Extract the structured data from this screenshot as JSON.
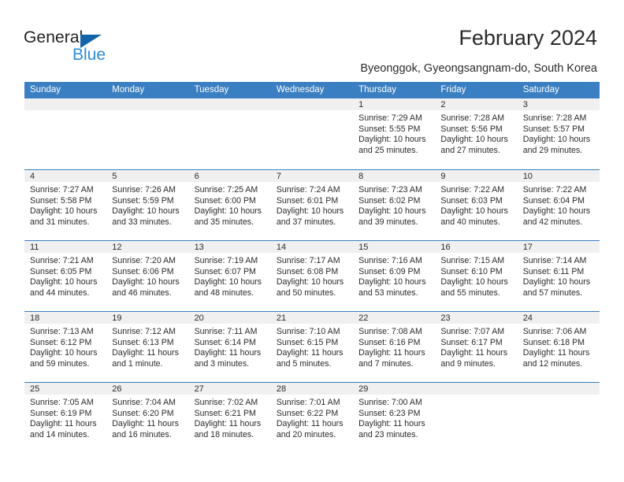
{
  "brand": {
    "name_top": "General",
    "name_bottom": "Blue",
    "triangle_color": "#1464aa",
    "bottom_color": "#2e8bd6",
    "top_color": "#231f20"
  },
  "header": {
    "title": "February 2024",
    "subtitle": "Byeonggok, Gyeongsangnam-do, South Korea"
  },
  "theme": {
    "header_bg": "#3a7fc1",
    "header_text": "#ffffff",
    "day_band_bg": "#f0f0f0",
    "text": "#2b2b2b"
  },
  "weekdays": [
    "Sunday",
    "Monday",
    "Tuesday",
    "Wednesday",
    "Thursday",
    "Friday",
    "Saturday"
  ],
  "weeks": [
    [
      {
        "day": "",
        "blank": true
      },
      {
        "day": "",
        "blank": true
      },
      {
        "day": "",
        "blank": true
      },
      {
        "day": "",
        "blank": true
      },
      {
        "day": "1",
        "sunrise": "Sunrise: 7:29 AM",
        "sunset": "Sunset: 5:55 PM",
        "daylight": "Daylight: 10 hours and 25 minutes."
      },
      {
        "day": "2",
        "sunrise": "Sunrise: 7:28 AM",
        "sunset": "Sunset: 5:56 PM",
        "daylight": "Daylight: 10 hours and 27 minutes."
      },
      {
        "day": "3",
        "sunrise": "Sunrise: 7:28 AM",
        "sunset": "Sunset: 5:57 PM",
        "daylight": "Daylight: 10 hours and 29 minutes."
      }
    ],
    [
      {
        "day": "4",
        "sunrise": "Sunrise: 7:27 AM",
        "sunset": "Sunset: 5:58 PM",
        "daylight": "Daylight: 10 hours and 31 minutes."
      },
      {
        "day": "5",
        "sunrise": "Sunrise: 7:26 AM",
        "sunset": "Sunset: 5:59 PM",
        "daylight": "Daylight: 10 hours and 33 minutes."
      },
      {
        "day": "6",
        "sunrise": "Sunrise: 7:25 AM",
        "sunset": "Sunset: 6:00 PM",
        "daylight": "Daylight: 10 hours and 35 minutes."
      },
      {
        "day": "7",
        "sunrise": "Sunrise: 7:24 AM",
        "sunset": "Sunset: 6:01 PM",
        "daylight": "Daylight: 10 hours and 37 minutes."
      },
      {
        "day": "8",
        "sunrise": "Sunrise: 7:23 AM",
        "sunset": "Sunset: 6:02 PM",
        "daylight": "Daylight: 10 hours and 39 minutes."
      },
      {
        "day": "9",
        "sunrise": "Sunrise: 7:22 AM",
        "sunset": "Sunset: 6:03 PM",
        "daylight": "Daylight: 10 hours and 40 minutes."
      },
      {
        "day": "10",
        "sunrise": "Sunrise: 7:22 AM",
        "sunset": "Sunset: 6:04 PM",
        "daylight": "Daylight: 10 hours and 42 minutes."
      }
    ],
    [
      {
        "day": "11",
        "sunrise": "Sunrise: 7:21 AM",
        "sunset": "Sunset: 6:05 PM",
        "daylight": "Daylight: 10 hours and 44 minutes."
      },
      {
        "day": "12",
        "sunrise": "Sunrise: 7:20 AM",
        "sunset": "Sunset: 6:06 PM",
        "daylight": "Daylight: 10 hours and 46 minutes."
      },
      {
        "day": "13",
        "sunrise": "Sunrise: 7:19 AM",
        "sunset": "Sunset: 6:07 PM",
        "daylight": "Daylight: 10 hours and 48 minutes."
      },
      {
        "day": "14",
        "sunrise": "Sunrise: 7:17 AM",
        "sunset": "Sunset: 6:08 PM",
        "daylight": "Daylight: 10 hours and 50 minutes."
      },
      {
        "day": "15",
        "sunrise": "Sunrise: 7:16 AM",
        "sunset": "Sunset: 6:09 PM",
        "daylight": "Daylight: 10 hours and 53 minutes."
      },
      {
        "day": "16",
        "sunrise": "Sunrise: 7:15 AM",
        "sunset": "Sunset: 6:10 PM",
        "daylight": "Daylight: 10 hours and 55 minutes."
      },
      {
        "day": "17",
        "sunrise": "Sunrise: 7:14 AM",
        "sunset": "Sunset: 6:11 PM",
        "daylight": "Daylight: 10 hours and 57 minutes."
      }
    ],
    [
      {
        "day": "18",
        "sunrise": "Sunrise: 7:13 AM",
        "sunset": "Sunset: 6:12 PM",
        "daylight": "Daylight: 10 hours and 59 minutes."
      },
      {
        "day": "19",
        "sunrise": "Sunrise: 7:12 AM",
        "sunset": "Sunset: 6:13 PM",
        "daylight": "Daylight: 11 hours and 1 minute."
      },
      {
        "day": "20",
        "sunrise": "Sunrise: 7:11 AM",
        "sunset": "Sunset: 6:14 PM",
        "daylight": "Daylight: 11 hours and 3 minutes."
      },
      {
        "day": "21",
        "sunrise": "Sunrise: 7:10 AM",
        "sunset": "Sunset: 6:15 PM",
        "daylight": "Daylight: 11 hours and 5 minutes."
      },
      {
        "day": "22",
        "sunrise": "Sunrise: 7:08 AM",
        "sunset": "Sunset: 6:16 PM",
        "daylight": "Daylight: 11 hours and 7 minutes."
      },
      {
        "day": "23",
        "sunrise": "Sunrise: 7:07 AM",
        "sunset": "Sunset: 6:17 PM",
        "daylight": "Daylight: 11 hours and 9 minutes."
      },
      {
        "day": "24",
        "sunrise": "Sunrise: 7:06 AM",
        "sunset": "Sunset: 6:18 PM",
        "daylight": "Daylight: 11 hours and 12 minutes."
      }
    ],
    [
      {
        "day": "25",
        "sunrise": "Sunrise: 7:05 AM",
        "sunset": "Sunset: 6:19 PM",
        "daylight": "Daylight: 11 hours and 14 minutes."
      },
      {
        "day": "26",
        "sunrise": "Sunrise: 7:04 AM",
        "sunset": "Sunset: 6:20 PM",
        "daylight": "Daylight: 11 hours and 16 minutes."
      },
      {
        "day": "27",
        "sunrise": "Sunrise: 7:02 AM",
        "sunset": "Sunset: 6:21 PM",
        "daylight": "Daylight: 11 hours and 18 minutes."
      },
      {
        "day": "28",
        "sunrise": "Sunrise: 7:01 AM",
        "sunset": "Sunset: 6:22 PM",
        "daylight": "Daylight: 11 hours and 20 minutes."
      },
      {
        "day": "29",
        "sunrise": "Sunrise: 7:00 AM",
        "sunset": "Sunset: 6:23 PM",
        "daylight": "Daylight: 11 hours and 23 minutes."
      },
      {
        "day": "",
        "blank": true
      },
      {
        "day": "",
        "blank": true
      }
    ]
  ]
}
